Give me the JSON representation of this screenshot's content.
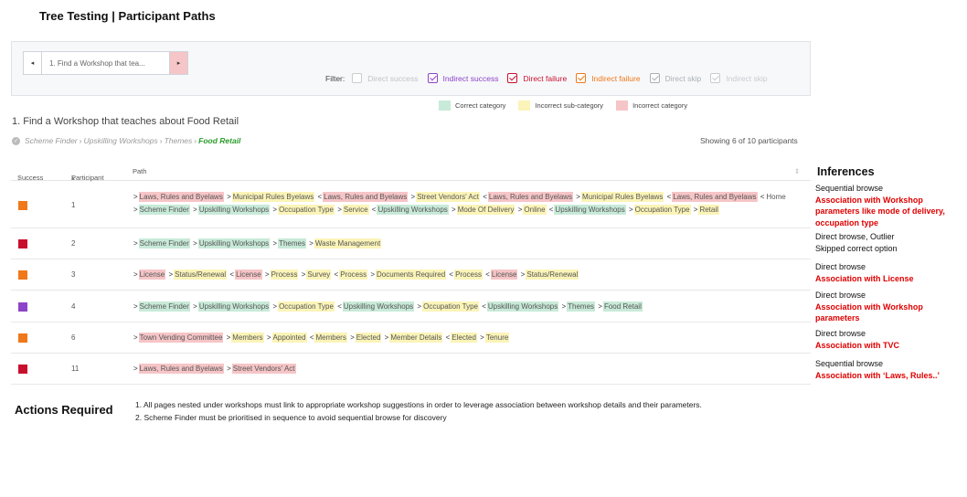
{
  "page_title": "Tree Testing | Participant Paths",
  "nav": {
    "prev_icon": "◂",
    "next_icon": "▸",
    "question_short": "1. Find a Workshop that tea..."
  },
  "filters": {
    "label": "Filter:",
    "items": [
      {
        "label": "Direct success",
        "checked": false,
        "color": "#c0c4c8"
      },
      {
        "label": "Indirect success",
        "checked": true,
        "color": "#8e44c8"
      },
      {
        "label": "Direct failure",
        "checked": true,
        "color": "#c8102e"
      },
      {
        "label": "Indirect failure",
        "checked": true,
        "color": "#f07818"
      },
      {
        "label": "Direct skip",
        "checked": true,
        "color": "#aab0b6"
      },
      {
        "label": "Indirect skip",
        "checked": true,
        "color": "#c8ccd0"
      }
    ]
  },
  "legend": [
    {
      "label": "Correct  category",
      "color": "#c8ead8"
    },
    {
      "label": "Incorrect  sub-category",
      "color": "#fbf4b8"
    },
    {
      "label": "Incorrect  category",
      "color": "#f6c5c7"
    }
  ],
  "question": "1. Find a Workshop that teaches about Food Retail",
  "correct_path": {
    "parts": [
      "Scheme Finder",
      "Upskilling Workshops",
      "Themes"
    ],
    "final": "Food Retail"
  },
  "showing": "Showing 6 of 10 participants",
  "table": {
    "headers": {
      "success": "Success",
      "participant": "Participant",
      "path": "Path"
    },
    "rows": [
      {
        "participant": "1",
        "color": "#f07818",
        "path": [
          [
            ">",
            "Laws, Rules and Byelaws",
            "r"
          ],
          [
            ">",
            "Municipal Rules Byelaws",
            "y"
          ],
          [
            "<",
            "Laws, Rules and Byelaws",
            "r"
          ],
          [
            ">",
            "Street Vendors' Act",
            "y"
          ],
          [
            "<",
            "Laws, Rules and Byelaws",
            "r"
          ],
          [
            ">",
            "Municipal Rules Byelaws",
            "y"
          ],
          [
            "<",
            "Laws, Rules and Byelaws",
            "r"
          ],
          [
            "<",
            "Home",
            ""
          ],
          [
            ">",
            "Scheme Finder",
            "g"
          ],
          [
            ">",
            "Upskilling Workshops",
            "g"
          ],
          [
            ">",
            "Occupation Type",
            "y"
          ],
          [
            ">",
            "Service",
            "y"
          ],
          [
            "<",
            "Upskilling Workshops",
            "g"
          ],
          [
            ">",
            "Mode Of Delivery",
            "y"
          ],
          [
            ">",
            "Online",
            "y"
          ],
          [
            "<",
            "Upskilling Workshops",
            "g"
          ],
          [
            ">",
            "Occupation Type",
            "y"
          ],
          [
            ">",
            "Retail",
            "y"
          ]
        ]
      },
      {
        "participant": "2",
        "color": "#c8102e",
        "path": [
          [
            ">",
            "Scheme Finder",
            "g"
          ],
          [
            ">",
            "Upskilling Workshops",
            "g"
          ],
          [
            ">",
            "Themes",
            "g"
          ],
          [
            ">",
            "Waste Management",
            "y"
          ]
        ]
      },
      {
        "participant": "3",
        "color": "#f07818",
        "path": [
          [
            ">",
            "License",
            "r"
          ],
          [
            ">",
            "Status/Renewal",
            "y"
          ],
          [
            "<",
            "License",
            "r"
          ],
          [
            ">",
            "Process",
            "y"
          ],
          [
            ">",
            "Survey",
            "y"
          ],
          [
            "<",
            "Process",
            "y"
          ],
          [
            ">",
            "Documents Required",
            "y"
          ],
          [
            "<",
            "Process",
            "y"
          ],
          [
            "<",
            "License",
            "r"
          ],
          [
            ">",
            "Status/Renewal",
            "y"
          ]
        ]
      },
      {
        "participant": "4",
        "color": "#8e44c8",
        "path": [
          [
            ">",
            "Scheme Finder",
            "g"
          ],
          [
            ">",
            "Upskilling Workshops",
            "g"
          ],
          [
            ">",
            "Occupation Type",
            "y"
          ],
          [
            "<",
            "Upskilling Workshops",
            "g"
          ],
          [
            ">",
            "Occupation Type",
            "y"
          ],
          [
            "<",
            "Upskilling Workshops",
            "g"
          ],
          [
            ">",
            "Themes",
            "g"
          ],
          [
            ">",
            "Food Retail",
            "g"
          ]
        ]
      },
      {
        "participant": "6",
        "color": "#f07818",
        "path": [
          [
            ">",
            "Town Vending Committee",
            "r"
          ],
          [
            ">",
            "Members",
            "y"
          ],
          [
            ">",
            "Appointed",
            "y"
          ],
          [
            "<",
            "Members",
            "y"
          ],
          [
            ">",
            "Elected",
            "y"
          ],
          [
            ">",
            "Member Details",
            "y"
          ],
          [
            "<",
            "Elected",
            "y"
          ],
          [
            ">",
            "Tenure",
            "y"
          ]
        ]
      },
      {
        "participant": "11",
        "color": "#c8102e",
        "path": [
          [
            ">",
            "Laws, Rules and Byelaws",
            "r"
          ],
          [
            ">",
            "Street Vendors' Act",
            "r"
          ]
        ]
      }
    ]
  },
  "inferences": {
    "title": "Inferences",
    "items": [
      {
        "lines": [
          "Sequential browse"
        ],
        "red": "Association with Workshop parameters like mode of delivery, occupation type"
      },
      {
        "lines": [
          "Direct browse, Outlier",
          "Skipped correct option"
        ],
        "red": ""
      },
      {
        "lines": [
          "Direct browse"
        ],
        "red": "Association with License"
      },
      {
        "lines": [
          "Direct browse"
        ],
        "red": "Association with Workshop parameters"
      },
      {
        "lines": [
          "Direct browse"
        ],
        "red": "Association with TVC"
      },
      {
        "lines": [
          "Sequential browse"
        ],
        "red": "Association with ‘Laws, Rules..’"
      }
    ]
  },
  "actions": {
    "title": "Actions Required",
    "items": [
      "1. All pages nested under workshops must link to appropriate workshop suggestions in order to leverage association between workshop details and their parameters.",
      "2. Scheme Finder must be prioritised in sequence to avoid sequential browse for discovery"
    ]
  }
}
